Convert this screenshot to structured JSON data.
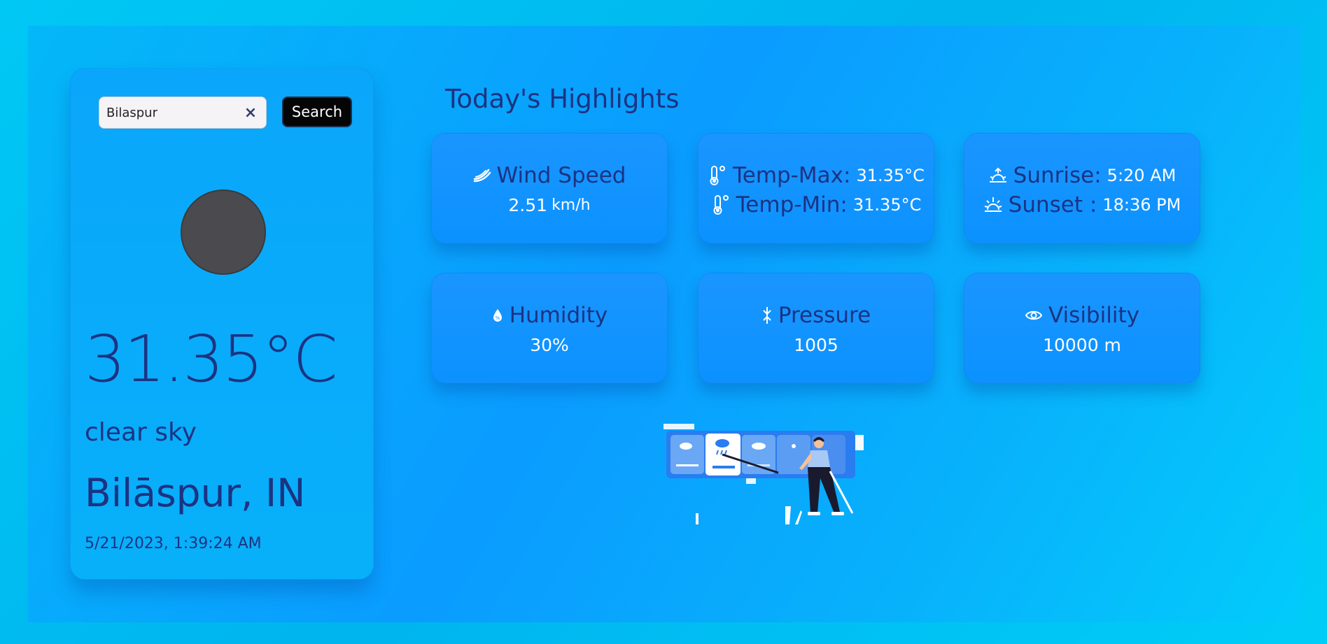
{
  "search": {
    "value": "Bilaspur",
    "clear_label": "×",
    "button_label": "Search"
  },
  "current": {
    "temperature": "31.35°C",
    "condition": "clear sky",
    "location": "Bilāspur, IN",
    "datetime": "5/21/2023, 1:39:24 AM"
  },
  "highlights": {
    "title": "Today's Highlights",
    "wind": {
      "label": "Wind Speed",
      "value": "2.51",
      "unit": "km/h",
      "icon": "wind-icon"
    },
    "temp_max": {
      "label": "Temp-Max:",
      "value": "31.35°C",
      "icon": "thermometer-icon"
    },
    "temp_min": {
      "label": "Temp-Min:",
      "value": "31.35°C",
      "icon": "thermometer-icon"
    },
    "sunrise": {
      "label": "Sunrise:",
      "value": "5:20 AM",
      "icon": "sunrise-icon"
    },
    "sunset": {
      "label": "Sunset :",
      "value": "18:36 PM",
      "icon": "sunset-icon"
    },
    "humidity": {
      "label": "Humidity",
      "value": "30%",
      "icon": "humidity-icon"
    },
    "pressure": {
      "label": "Pressure",
      "value": "1005",
      "icon": "pressure-icon"
    },
    "visibility": {
      "label": "Visibility",
      "value": "10000 m",
      "icon": "eye-icon"
    }
  },
  "colors": {
    "accent_text": "#1c3382",
    "value_text": "#ffffff",
    "card_bg": "#0b92ff",
    "page_bg": "#00c8f5"
  }
}
